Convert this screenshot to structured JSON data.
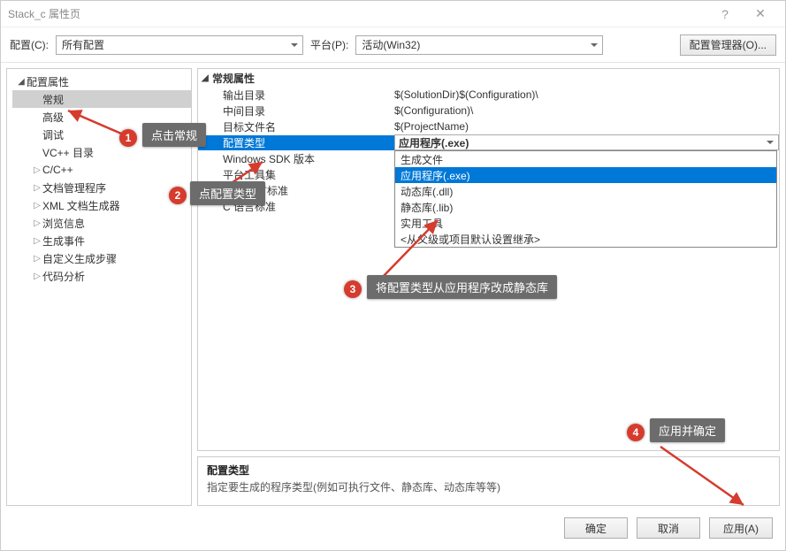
{
  "title": "Stack_c 属性页",
  "toolbar": {
    "config_label": "配置(C):",
    "config_value": "所有配置",
    "platform_label": "平台(P):",
    "platform_value": "活动(Win32)",
    "manager_button": "配置管理器(O)..."
  },
  "tree": {
    "root": "配置属性",
    "items": [
      "常规",
      "高级",
      "调试",
      "VC++ 目录",
      "C/C++",
      "文档管理程序",
      "XML 文档生成器",
      "浏览信息",
      "生成事件",
      "自定义生成步骤",
      "代码分析"
    ],
    "expandable": [
      false,
      false,
      false,
      false,
      true,
      true,
      true,
      true,
      true,
      true,
      true
    ]
  },
  "grid": {
    "group": "常规属性",
    "rows": [
      {
        "name": "输出目录",
        "value": "$(SolutionDir)$(Configuration)\\"
      },
      {
        "name": "中间目录",
        "value": "$(Configuration)\\"
      },
      {
        "name": "目标文件名",
        "value": "$(ProjectName)"
      },
      {
        "name": "配置类型",
        "value": "应用程序(.exe)"
      },
      {
        "name": "Windows SDK 版本",
        "value": ""
      },
      {
        "name": "平台工具集",
        "value": ""
      },
      {
        "name": "C++ 语言标准",
        "value": ""
      },
      {
        "name": "C 语言标准",
        "value": ""
      }
    ]
  },
  "dropdown": [
    "生成文件",
    "应用程序(.exe)",
    "动态库(.dll)",
    "静态库(.lib)",
    "实用工具",
    "<从父级或项目默认设置继承>"
  ],
  "description": {
    "title": "配置类型",
    "text": "指定要生成的程序类型(例如可执行文件、静态库、动态库等等)"
  },
  "buttons": {
    "ok": "确定",
    "cancel": "取消",
    "apply": "应用(A)"
  },
  "annotations": {
    "step1": "点击常规",
    "step2": "点配置类型",
    "step3": "将配置类型从应用程序改成静态库",
    "step4": "应用并确定"
  }
}
